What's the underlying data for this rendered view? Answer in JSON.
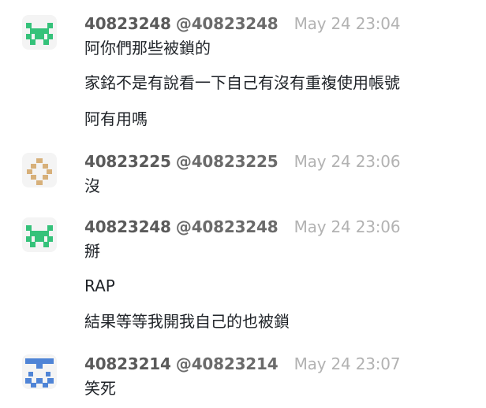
{
  "messages": [
    {
      "author": "40823248",
      "handle": "@40823248",
      "time": "May 24 23:04",
      "avatar": {
        "name": "green-space-invader-avatar",
        "color": "#35c27a"
      },
      "lines": [
        "阿你們那些被鎖的",
        "家銘不是有說看一下自己有沒有重複使用帳號",
        "阿有用嗎"
      ]
    },
    {
      "author": "40823225",
      "handle": "@40823225",
      "time": "May 24 23:06",
      "avatar": {
        "name": "tan-diamond-avatar",
        "color": "#d7b07a"
      },
      "lines": [
        "沒"
      ]
    },
    {
      "author": "40823248",
      "handle": "@40823248",
      "time": "May 24 23:06",
      "avatar": {
        "name": "green-space-invader-avatar",
        "color": "#35c27a"
      },
      "lines": [
        "掰",
        "RAP",
        "結果等等我開我自己的也被鎖"
      ]
    },
    {
      "author": "40823214",
      "handle": "@40823214",
      "time": "May 24 23:07",
      "avatar": {
        "name": "blue-pixel-avatar",
        "color": "#4f84d6"
      },
      "lines": [
        "笑死"
      ]
    }
  ]
}
